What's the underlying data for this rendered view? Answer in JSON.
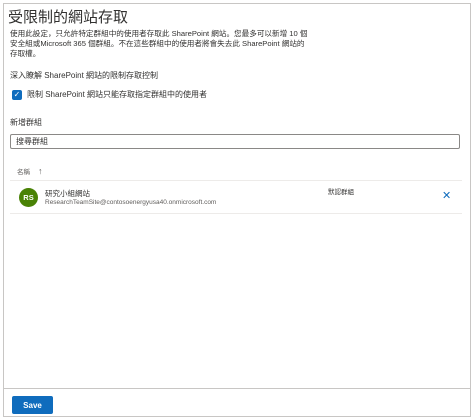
{
  "panel": {
    "title": "受限制的網站存取",
    "description": "使用此設定，只允許特定群組中的使用者存取此 SharePoint 網站。您最多可以新增 10 個安全組或Microsoft 365 個群組。不在這些群組中的使用者將會失去此 SharePoint 網站的存取權。",
    "learn_more": "深入瞭解 SharePoint 網站的限制存取控制",
    "checkbox_label": "限制 SharePoint 網站只能存取指定群組中的使用者",
    "add_group_label": "新增群組",
    "search_value": "搜尋群組"
  },
  "table": {
    "column_name": "名稱",
    "rows": [
      {
        "initials": "RS",
        "name": "研究小組網站",
        "email": "ResearchTeamSite@contosoenergyusa40.onmicrosoft.com",
        "type": "默認群組"
      }
    ]
  },
  "footer": {
    "save_label": "Save"
  },
  "colors": {
    "accent": "#0f6cbd",
    "avatar": "#498205"
  },
  "icons": {
    "checkbox": "checkmark-icon",
    "sort": "sort-ascending-icon",
    "remove": "close-icon"
  }
}
